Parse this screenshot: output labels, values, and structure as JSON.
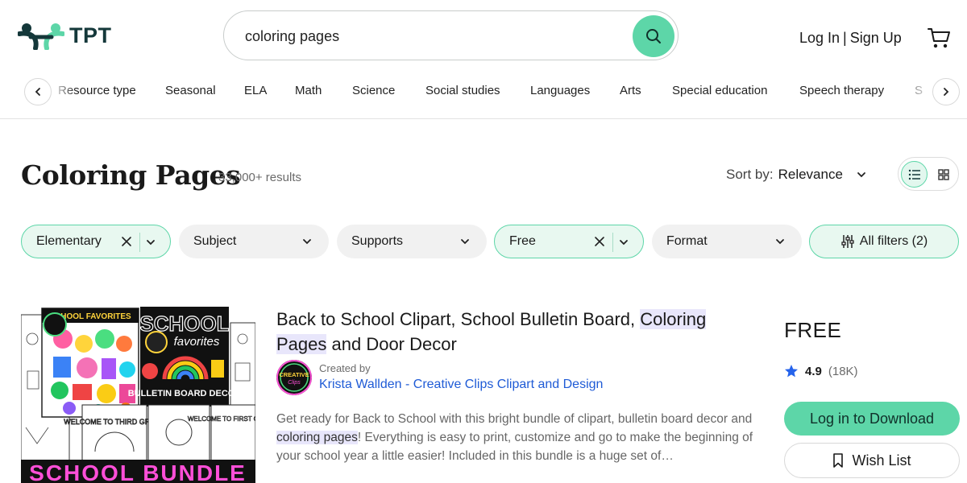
{
  "brand": {
    "name": "TPT",
    "accent": "#5dd6a8",
    "dark": "#14383a"
  },
  "search": {
    "value": "coloring pages",
    "placeholder": "Search"
  },
  "auth": {
    "login": "Log In",
    "separator": "|",
    "signup": "Sign Up"
  },
  "categories": [
    "Resource type",
    "Seasonal",
    "ELA",
    "Math",
    "Science",
    "Social studies",
    "Languages",
    "Arts",
    "Special education",
    "Speech therapy",
    "S"
  ],
  "page": {
    "title": "Coloring Pages",
    "results": "33,000+ results"
  },
  "sort": {
    "label": "Sort by:",
    "value": "Relevance"
  },
  "filters": [
    {
      "label": "Elementary",
      "active": true,
      "removable": true
    },
    {
      "label": "Subject",
      "active": false
    },
    {
      "label": "Supports",
      "active": false
    },
    {
      "label": "Free",
      "active": true,
      "removable": true
    },
    {
      "label": "Format",
      "active": false
    },
    {
      "label": "All filters (2)",
      "active": true
    }
  ],
  "product": {
    "title_parts": [
      "Back to School Clipart, School Bulletin Board, ",
      "Coloring Pages",
      " and Door Decor"
    ],
    "created_by": "Created by",
    "creator": "Krista Wallden - Creative Clips Clipart and Design",
    "desc_parts": [
      "Get ready for Back to School with this bright bundle of clipart, bulletin board decor and ",
      "coloring pages",
      "! Everything is easy to print, customize and go to make the beginning of your school year a little easier! Included in this bundle is a huge set of…"
    ],
    "price": "FREE",
    "rating": "4.9",
    "rating_count": "(18K)",
    "download": "Log in to Download",
    "wishlist": "Wish List",
    "thumb_text": {
      "favorites": "SCHOOL FAVORITES",
      "school": "SCHOOL",
      "favorites_script": "favorites",
      "bulletin": "BULLETIN BOARD DECOR",
      "welcome_third": "WELCOME TO THIRD GRADE",
      "welcome_first": "WELCOME TO FIRST GRADE",
      "bundle": "SCHOOL BUNDLE",
      "creative": "CREATIVE",
      "clips": "Clips"
    }
  }
}
